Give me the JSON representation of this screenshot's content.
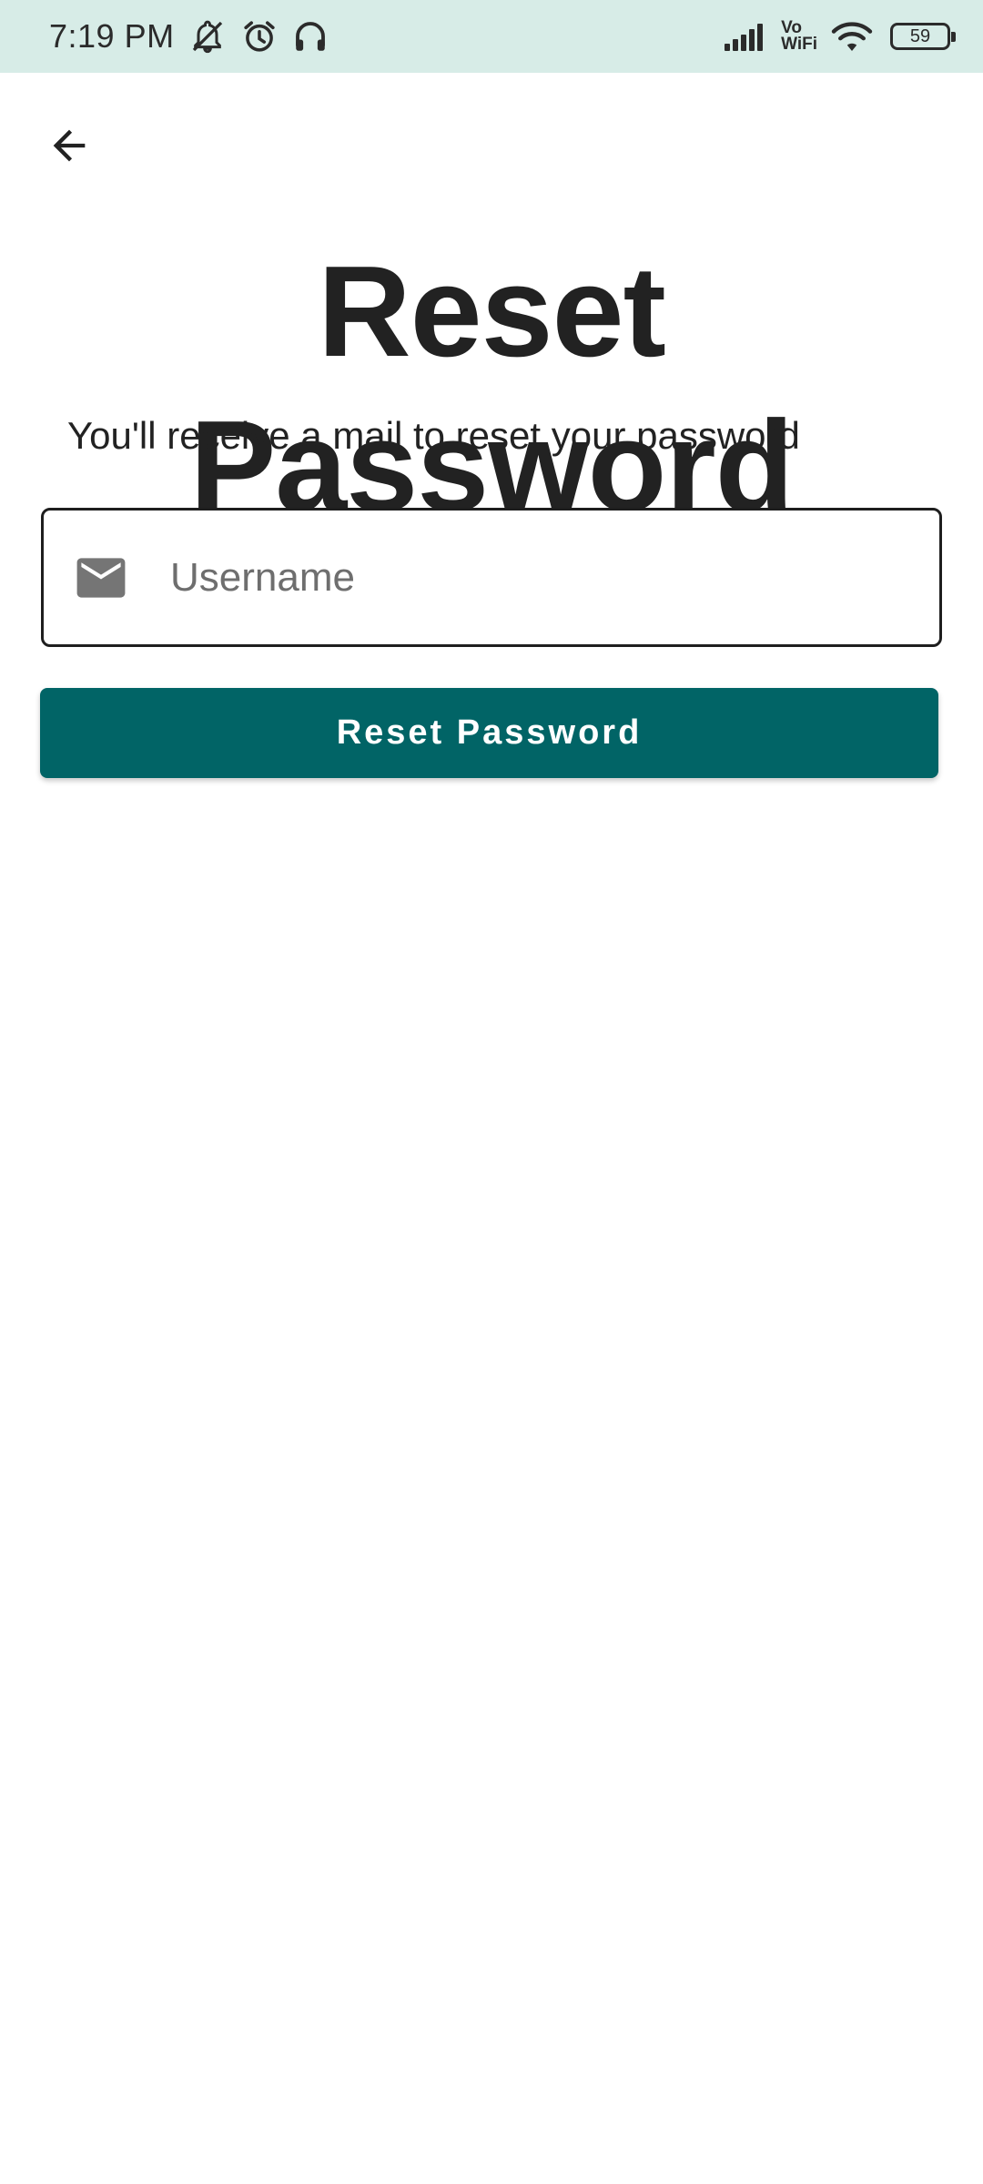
{
  "status_bar": {
    "time": "7:19 PM",
    "network_label_top": "Vo",
    "network_label_bottom": "WiFi",
    "battery_level": "59",
    "icons": [
      "bell-off-icon",
      "alarm-icon",
      "headphones-icon",
      "signal-icon",
      "vowifi-icon",
      "wifi-icon",
      "battery-icon"
    ]
  },
  "header": {
    "back_icon": "arrow-back-icon"
  },
  "main": {
    "title": "Reset Password",
    "subtitle": "You'll receive a mail to reset your password",
    "username_input": {
      "icon": "mail-icon",
      "placeholder": "Username",
      "value": ""
    },
    "submit_label": "Reset Password"
  },
  "colors": {
    "status_bar_bg": "#d7ece7",
    "accent": "#016466",
    "text": "#222222"
  }
}
